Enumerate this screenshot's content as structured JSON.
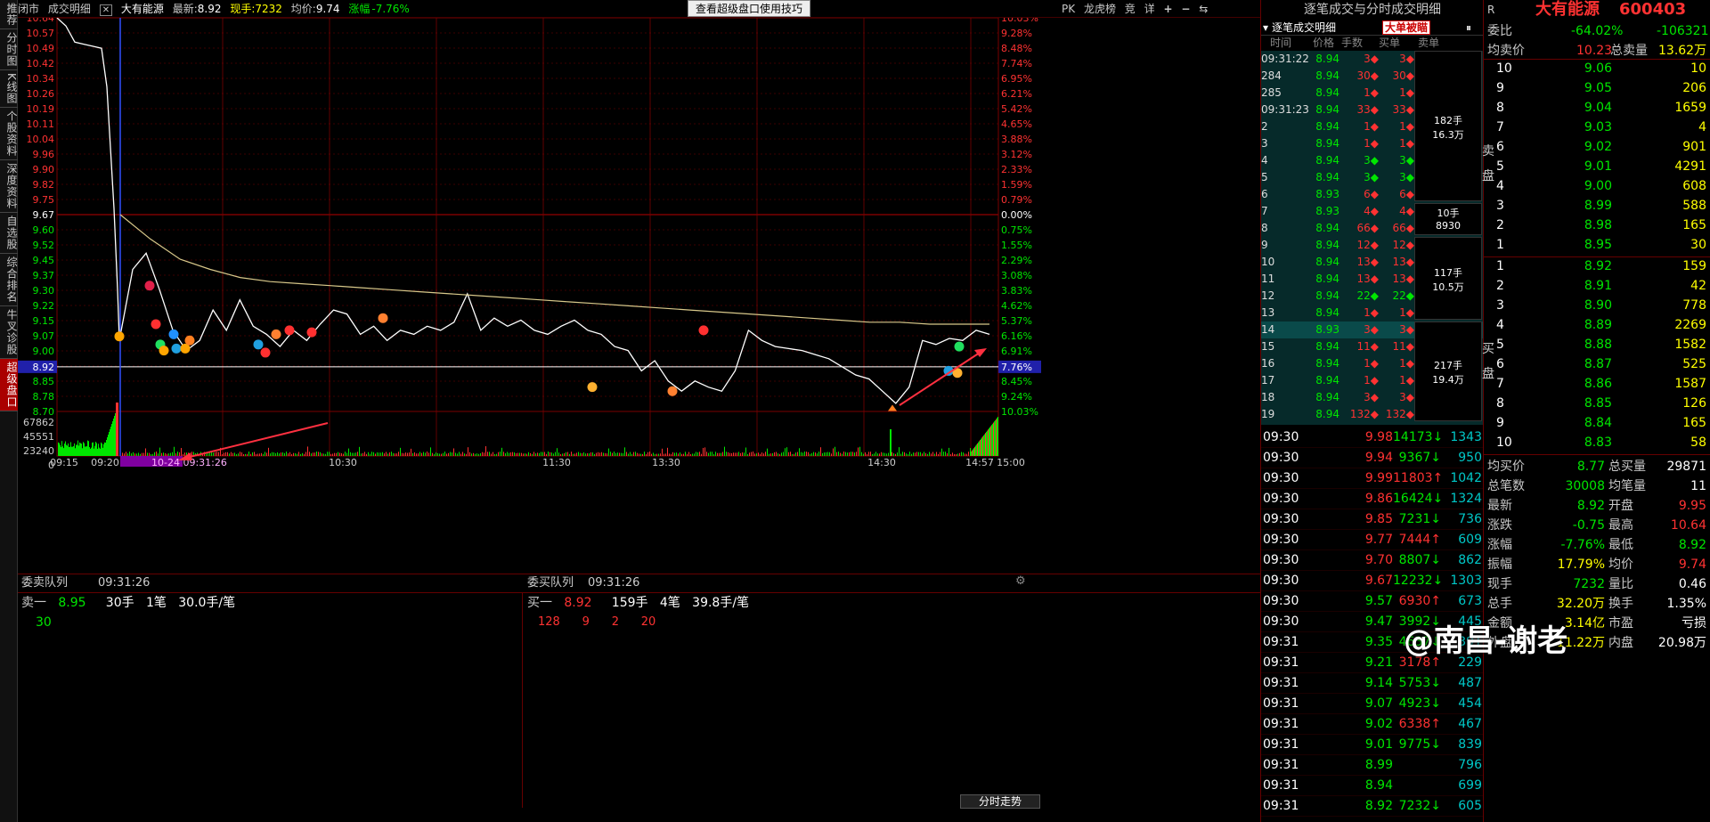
{
  "sidebar": {
    "items": [
      "推荐",
      "分时图",
      "K线图",
      "个股资料",
      "深度资料",
      "自选股",
      "综合排名",
      "牛叉诊股",
      "超级盘口"
    ]
  },
  "topbar": {
    "left_tabs": [
      "闭市",
      "成交明细"
    ],
    "stock_name": "大有能源",
    "latest_label": "最新:",
    "latest": "8.92",
    "volume_label": "现手:",
    "volume": "7232",
    "avg_label": "均价:",
    "avg": "9.74",
    "change_label": "涨幅",
    "change": "-7.76%",
    "tip_button": "查看超级盘口使用技巧",
    "right_buttons": [
      "PK",
      "龙虎榜",
      "竞",
      "详",
      "+",
      "−",
      "⇆"
    ]
  },
  "chart": {
    "price_labels": [
      "10.64",
      "10.57",
      "10.49",
      "10.42",
      "10.34",
      "10.26",
      "10.19",
      "10.11",
      "10.04",
      "9.96",
      "9.90",
      "9.82",
      "9.75",
      "9.67",
      "9.60",
      "9.52",
      "9.45",
      "9.37",
      "9.30",
      "9.22",
      "9.15",
      "9.07",
      "9.00",
      "8.92",
      "8.85",
      "8.78",
      "8.70"
    ],
    "pct_labels": [
      "10.03%",
      "9.28%",
      "8.48%",
      "7.74%",
      "6.95%",
      "6.21%",
      "5.42%",
      "4.65%",
      "3.88%",
      "3.12%",
      "2.33%",
      "1.59%",
      "0.79%",
      "0.00%",
      "0.75%",
      "1.55%",
      "2.29%",
      "3.08%",
      "3.83%",
      "4.62%",
      "5.37%",
      "6.16%",
      "6.91%",
      "7.76%",
      "8.45%",
      "9.24%",
      "10.03%"
    ],
    "vol_labels": [
      "67862",
      "45551",
      "23240",
      "0"
    ],
    "time_labels": [
      "09:15",
      "09:20",
      "10-24 09:31:26",
      "10:30",
      "11:30",
      "13:30",
      "14:30",
      "14:57",
      "15:00"
    ],
    "colors": {
      "up": "#ff3232",
      "down": "#00e600",
      "price": "#ffffff",
      "avg": "#d8c88a",
      "grid": "#7a0000",
      "current": "#2020aa"
    },
    "price_line": [
      10.64,
      10.6,
      10.52,
      10.51,
      10.5,
      10.49,
      10.3,
      10.0,
      9.7,
      9.3,
      9.05,
      9.4,
      9.48,
      9.3,
      9.1,
      9.0,
      9.05,
      9.2,
      9.1,
      9.25,
      9.12,
      9.08,
      9.02,
      9.1,
      9.05,
      9.13,
      9.2,
      9.18,
      9.08,
      9.12,
      9.05,
      9.1,
      9.08,
      9.12,
      9.1,
      9.14,
      9.28,
      9.1,
      9.16,
      9.12,
      9.15,
      9.1,
      9.08,
      9.12,
      9.15,
      9.1,
      9.08,
      9.02,
      9.0,
      8.9,
      8.95,
      8.85,
      8.8,
      8.85,
      8.82,
      8.8,
      8.9,
      9.1,
      9.05,
      9.02,
      9.01,
      9.0,
      8.98,
      8.96,
      8.92,
      8.88,
      8.86,
      8.8,
      8.74,
      8.82,
      9.05,
      9.03,
      9.06,
      9.05,
      9.1,
      9.08
    ],
    "avg_line": [
      9.67,
      9.55,
      9.45,
      9.4,
      9.36,
      9.34,
      9.33,
      9.32,
      9.31,
      9.3,
      9.29,
      9.28,
      9.27,
      9.26,
      9.25,
      9.24,
      9.23,
      9.22,
      9.21,
      9.2,
      9.19,
      9.18,
      9.17,
      9.16,
      9.15,
      9.14,
      9.14,
      9.13,
      9.13,
      9.13
    ]
  },
  "queue": {
    "sell_title": "委卖队列",
    "sell_time": "09:31:26",
    "buy_title": "委买队列",
    "buy_time": "09:31:26",
    "sell_level": "卖一",
    "sell_price": "8.95",
    "sell_vol": "30手",
    "sell_cnt": "1笔",
    "sell_avg": "30.0手/笔",
    "sell_orders": [
      "30"
    ],
    "buy_level": "买一",
    "buy_price": "8.92",
    "buy_vol": "159手",
    "buy_cnt": "4笔",
    "buy_avg": "39.8手/笔",
    "buy_orders": [
      "128",
      "9",
      "2",
      "20"
    ],
    "footer": "分时走势"
  },
  "ticker": {
    "title": "逐笔成交与分时成交明细",
    "sub_title": "逐笔成交明细",
    "big_btn": "大单被瞄",
    "headers": [
      "时间",
      "价格",
      "手数",
      "买单",
      "卖单"
    ],
    "rows": [
      [
        "09:31:22",
        "8.94",
        "3",
        "3"
      ],
      [
        "284",
        "8.94",
        "30",
        "30"
      ],
      [
        "285",
        "8.94",
        "1",
        "1"
      ],
      [
        "09:31:23",
        "8.94",
        "33",
        "33"
      ],
      [
        "2",
        "8.94",
        "1",
        "1"
      ],
      [
        "3",
        "8.94",
        "1",
        "1"
      ],
      [
        "4",
        "8.94",
        "3",
        "3"
      ],
      [
        "5",
        "8.94",
        "3",
        "3"
      ],
      [
        "6",
        "8.93",
        "6",
        "6"
      ],
      [
        "7",
        "8.93",
        "4",
        "4"
      ],
      [
        "8",
        "8.94",
        "66",
        "66"
      ],
      [
        "9",
        "8.94",
        "12",
        "12"
      ],
      [
        "10",
        "8.94",
        "13",
        "13"
      ],
      [
        "11",
        "8.94",
        "13",
        "13"
      ],
      [
        "12",
        "8.94",
        "22",
        "22"
      ],
      [
        "13",
        "8.94",
        "1",
        "1"
      ],
      [
        "14",
        "8.93",
        "3",
        "3"
      ],
      [
        "15",
        "8.94",
        "11",
        "11"
      ],
      [
        "16",
        "8.94",
        "1",
        "1"
      ],
      [
        "17",
        "8.94",
        "1",
        "1"
      ],
      [
        "18",
        "8.94",
        "3",
        "3"
      ],
      [
        "19",
        "8.94",
        "132",
        "132"
      ]
    ],
    "groups": [
      {
        "vol": "182手",
        "amt": "16.3万"
      },
      {
        "vol": "10手",
        "amt": "8930"
      },
      {
        "vol": "117手",
        "amt": "10.5万"
      },
      {
        "vol": "217手",
        "amt": "19.4万"
      }
    ],
    "big": [
      [
        "09:30",
        "9.98",
        "14173",
        "1343"
      ],
      [
        "09:30",
        "9.94",
        "9367",
        "950"
      ],
      [
        "09:30",
        "9.99",
        "11803",
        "1042"
      ],
      [
        "09:30",
        "9.86",
        "16424",
        "1324"
      ],
      [
        "09:30",
        "9.85",
        "7231",
        "736"
      ],
      [
        "09:30",
        "9.77",
        "7444",
        "609"
      ],
      [
        "09:30",
        "9.70",
        "8807",
        "862"
      ],
      [
        "09:30",
        "9.67",
        "12232",
        "1303"
      ],
      [
        "09:30",
        "9.57",
        "6930",
        "673"
      ],
      [
        "09:30",
        "9.47",
        "3992",
        "445"
      ],
      [
        "09:31",
        "9.35",
        "4637",
        "391"
      ],
      [
        "09:31",
        "9.21",
        "3178",
        "229"
      ],
      [
        "09:31",
        "9.14",
        "5753",
        "487"
      ],
      [
        "09:31",
        "9.07",
        "4923",
        "454"
      ],
      [
        "09:31",
        "9.02",
        "6338",
        "467"
      ],
      [
        "09:31",
        "9.01",
        "9775",
        "839"
      ],
      [
        "09:31",
        "8.99",
        "",
        "796"
      ],
      [
        "09:31",
        "8.94",
        "",
        "699"
      ],
      [
        "09:31",
        "8.92",
        "7232",
        "605"
      ]
    ]
  },
  "quote": {
    "name": "大有能源",
    "code": "600403",
    "wb_label": "委比",
    "wb": "-64.02%",
    "wb_diff": "-106321",
    "avg_sell_label": "均卖价",
    "avg_sell": "10.23",
    "total_sell_label": "总卖量",
    "total_sell": "13.62万",
    "sells": [
      [
        "10",
        "9.06",
        "10"
      ],
      [
        "9",
        "9.05",
        "206"
      ],
      [
        "8",
        "9.04",
        "1659"
      ],
      [
        "7",
        "9.03",
        "4"
      ],
      [
        "6",
        "9.02",
        "901"
      ],
      [
        "5",
        "9.01",
        "4291"
      ],
      [
        "4",
        "9.00",
        "608"
      ],
      [
        "3",
        "8.99",
        "588"
      ],
      [
        "2",
        "8.98",
        "165"
      ],
      [
        "1",
        "8.95",
        "30"
      ]
    ],
    "buys": [
      [
        "1",
        "8.92",
        "159"
      ],
      [
        "2",
        "8.91",
        "42"
      ],
      [
        "3",
        "8.90",
        "778"
      ],
      [
        "4",
        "8.89",
        "2269"
      ],
      [
        "5",
        "8.88",
        "1582"
      ],
      [
        "6",
        "8.87",
        "525"
      ],
      [
        "7",
        "8.86",
        "1587"
      ],
      [
        "8",
        "8.85",
        "126"
      ],
      [
        "9",
        "8.84",
        "165"
      ],
      [
        "10",
        "8.83",
        "58"
      ]
    ],
    "sell_side": "卖盘",
    "buy_side": "买盘",
    "stats": [
      [
        "均买价",
        "8.77",
        "总买量",
        "29871"
      ],
      [
        "总笔数",
        "30008",
        "均笔量",
        "11"
      ],
      [
        "最新",
        "8.92",
        "开盘",
        "9.95"
      ],
      [
        "涨跌",
        "-0.75",
        "最高",
        "10.64"
      ],
      [
        "涨幅",
        "-7.76%",
        "最低",
        "8.92"
      ],
      [
        "振幅",
        "17.79%",
        "均价",
        "9.74"
      ],
      [
        "现手",
        "7232",
        "量比",
        "0.46"
      ],
      [
        "总手",
        "32.20万",
        "换手",
        "1.35%"
      ],
      [
        "金额",
        "3.14亿",
        "市盈",
        "亏损"
      ],
      [
        "外盘",
        "11.22万",
        "内盘",
        "20.98万"
      ]
    ],
    "watermark": "@南昌-谢老"
  }
}
